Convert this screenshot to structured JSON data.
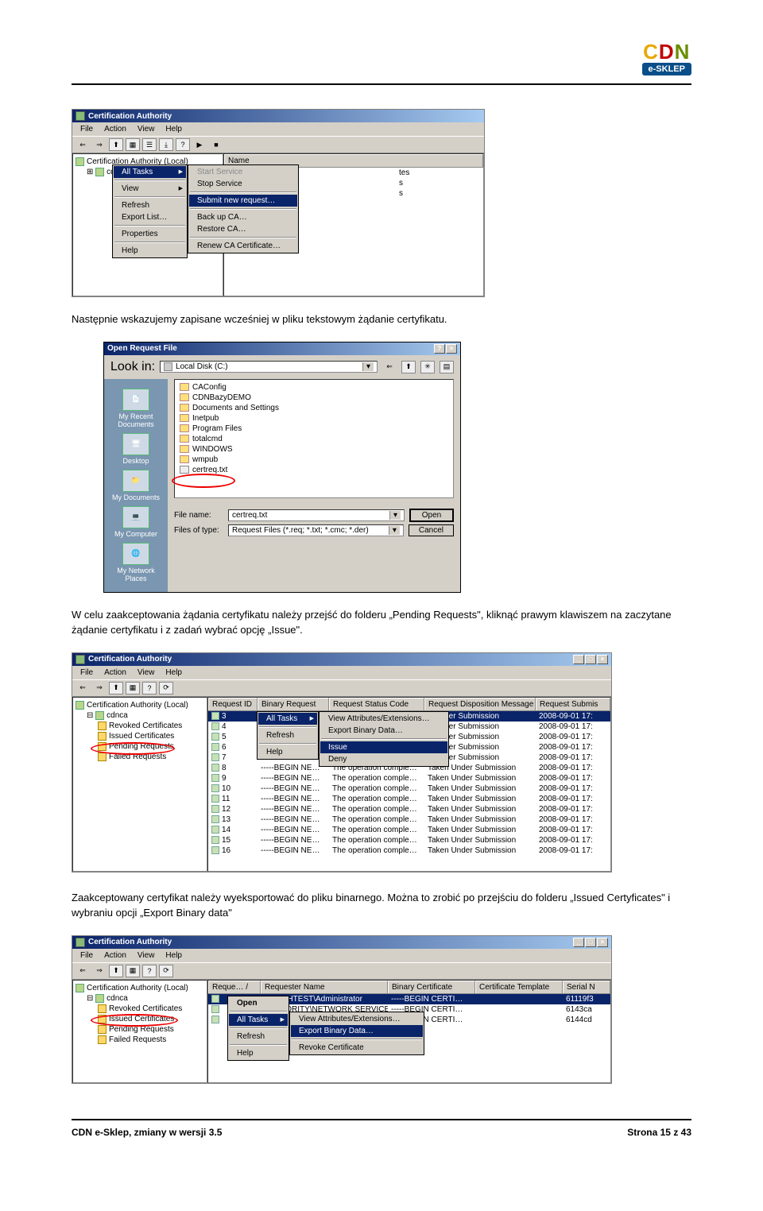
{
  "brand": {
    "c": "C",
    "d": "D",
    "n": "N",
    "sub": "e-SKLEP"
  },
  "text": {
    "p1": "Następnie wskazujemy zapisane wcześniej w pliku tekstowym żądanie certyfikatu.",
    "p2": "W celu zaakceptowania żądania certyfikatu należy przejść do folderu „Pending Requests\", kliknąć prawym klawiszem na zaczytane żądanie certyfikatu i z zadań wybrać opcję „Issue\".",
    "p3": "Zaakceptowany certyfikat należy wyeksportować do pliku binarnego. Można to zrobić po przejściu do folderu „Issued Certyficates\" i wybraniu opcji „Export Binary data\""
  },
  "footer": {
    "left": "CDN e-Sklep, zmiany w wersji 3.5",
    "right": "Strona 15 z 43"
  },
  "shot1": {
    "title": "Certification Authority",
    "menus": [
      "File",
      "Action",
      "View",
      "Help"
    ],
    "tree_root": "Certification Authority (Local)",
    "tree_child": "cd",
    "list_col": "Name",
    "list_suffix": [
      "tes",
      "s",
      "s"
    ],
    "ctx1": [
      "All Tasks",
      "View",
      "Refresh",
      "Export List…",
      "Properties",
      "Help"
    ],
    "ctx2": {
      "start": "Start Service",
      "stop": "Stop Service",
      "submit": "Submit new request…",
      "backup": "Back up CA…",
      "restore": "Restore CA…",
      "renew": "Renew CA Certificate…"
    }
  },
  "shot2": {
    "title": "Open Request File",
    "lookin_label": "Look in:",
    "lookin_value": "Local Disk (C:)",
    "places": [
      "My Recent Documents",
      "Desktop",
      "My Documents",
      "My Computer",
      "My Network Places"
    ],
    "files": [
      "CAConfig",
      "CDNBazyDEMO",
      "Documents and Settings",
      "Inetpub",
      "Program Files",
      "totalcmd",
      "WINDOWS",
      "wmpub",
      "certreq.txt"
    ],
    "filename_label": "File name:",
    "filename_value": "certreq.txt",
    "filetype_label": "Files of type:",
    "filetype_value": "Request Files (*.req; *.txt; *.cmc; *.der)",
    "open": "Open",
    "cancel": "Cancel"
  },
  "shot3": {
    "title": "Certification Authority",
    "menus": [
      "File",
      "Action",
      "View",
      "Help"
    ],
    "tree": {
      "root": "Certification Authority (Local)",
      "ca": "cdnca",
      "items": [
        "Revoked Certificates",
        "Issued Certificates",
        "Pending Requests",
        "Failed Requests"
      ]
    },
    "cols": [
      "Request ID",
      "Binary Request",
      "Request Status Code",
      "Request Disposition Message",
      "Request Submis"
    ],
    "ctx1": [
      "All Tasks",
      "Refresh",
      "Help"
    ],
    "ctx2": [
      "View Attributes/Extensions…",
      "Export Binary Data…",
      "Issue",
      "Deny"
    ],
    "rows": [
      {
        "id": "3",
        "br": "",
        "sc": "",
        "dm": "n Under Submission",
        "ts": "2008-09-01 17:"
      },
      {
        "id": "4",
        "br": "",
        "sc": "",
        "dm": "n Under Submission",
        "ts": "2008-09-01 17:"
      },
      {
        "id": "5",
        "br": "",
        "sc": "",
        "dm": "n Under Submission",
        "ts": "2008-09-01 17:"
      },
      {
        "id": "6",
        "br": "",
        "sc": "",
        "dm": "n Under Submission",
        "ts": "2008-09-01 17:"
      },
      {
        "id": "7",
        "br": "",
        "sc": "",
        "dm": "n Under Submission",
        "ts": "2008-09-01 17:"
      },
      {
        "id": "8",
        "br": "-----BEGIN NE…",
        "sc": "The operation comple…",
        "dm": "Taken Under Submission",
        "ts": "2008-09-01 17:"
      },
      {
        "id": "9",
        "br": "-----BEGIN NE…",
        "sc": "The operation comple…",
        "dm": "Taken Under Submission",
        "ts": "2008-09-01 17:"
      },
      {
        "id": "10",
        "br": "-----BEGIN NE…",
        "sc": "The operation comple…",
        "dm": "Taken Under Submission",
        "ts": "2008-09-01 17:"
      },
      {
        "id": "11",
        "br": "-----BEGIN NE…",
        "sc": "The operation comple…",
        "dm": "Taken Under Submission",
        "ts": "2008-09-01 17:"
      },
      {
        "id": "12",
        "br": "-----BEGIN NE…",
        "sc": "The operation comple…",
        "dm": "Taken Under Submission",
        "ts": "2008-09-01 17:"
      },
      {
        "id": "13",
        "br": "-----BEGIN NE…",
        "sc": "The operation comple…",
        "dm": "Taken Under Submission",
        "ts": "2008-09-01 17:"
      },
      {
        "id": "14",
        "br": "-----BEGIN NE…",
        "sc": "The operation comple…",
        "dm": "Taken Under Submission",
        "ts": "2008-09-01 17:"
      },
      {
        "id": "15",
        "br": "-----BEGIN NE…",
        "sc": "The operation comple…",
        "dm": "Taken Under Submission",
        "ts": "2008-09-01 17:"
      },
      {
        "id": "16",
        "br": "-----BEGIN NE…",
        "sc": "The operation comple…",
        "dm": "Taken Under Submission",
        "ts": "2008-09-01 17:"
      }
    ]
  },
  "shot4": {
    "title": "Certification Authority",
    "menus": [
      "File",
      "Action",
      "View",
      "Help"
    ],
    "tree": {
      "root": "Certification Authority (Local)",
      "ca": "cdnca",
      "items": [
        "Revoked Certificates",
        "Issued Certificates",
        "Pending Requests",
        "Failed Requests"
      ]
    },
    "cols": [
      "Reque…  /",
      "Requester Name",
      "Binary Certificate",
      "Certificate Template",
      "Serial N"
    ],
    "ctx1": [
      "Open",
      "All Tasks",
      "Refresh",
      "Help"
    ],
    "ctx2": [
      "View Attributes/Extensions…",
      "Export Binary Data…",
      "Revoke Certificate"
    ],
    "rows": [
      {
        "rn": "MARCHTEST\\Administrator",
        "bc": "-----BEGIN CERTI…",
        "ct": "",
        "sn": "61119f3"
      },
      {
        "rn": "AUTHORITY\\NETWORK SERVICE",
        "bc": "-----BEGIN CERTI…",
        "ct": "",
        "sn": "6143ca"
      },
      {
        "rn": "",
        "bc": "-----BEGIN CERTI…",
        "ct": "",
        "sn": "6144cd"
      }
    ]
  }
}
